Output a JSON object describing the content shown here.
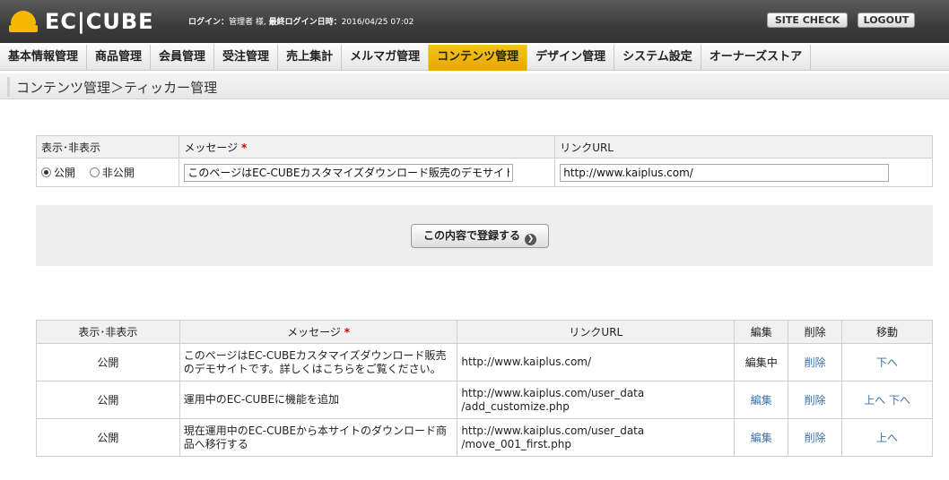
{
  "header": {
    "logo_text": "EC|CUBE",
    "login_label": "ログイン：",
    "user": "管理者 様,",
    "last_login_label": "最終ログイン日時：",
    "last_login": "2016/04/25 07:02",
    "site_check": "SITE CHECK",
    "logout": "LOGOUT",
    "brand_color": "#f5b800"
  },
  "nav": {
    "items": [
      "基本情報管理",
      "商品管理",
      "会員管理",
      "受注管理",
      "売上集計",
      "メルマガ管理",
      "コンテンツ管理",
      "デザイン管理",
      "システム設定",
      "オーナーズストア"
    ],
    "active_index": 6
  },
  "page": {
    "title": "コンテンツ管理＞ティッカー管理"
  },
  "form": {
    "col_display": "表示･非表示",
    "col_message": "メッセージ",
    "required_mark": "*",
    "col_url": "リンクURL",
    "radio_public": "公開",
    "radio_private": "非公開",
    "message_value": "このページはEC-CUBEカスタマイズダウンロード販売のデモサイトで",
    "url_value": "http://www.kaiplus.com/",
    "submit_label": "この内容で登録する"
  },
  "list": {
    "headers": {
      "display": "表示･非表示",
      "message": "メッセージ",
      "url": "リンクURL",
      "edit": "編集",
      "delete": "削除",
      "move": "移動"
    },
    "rows": [
      {
        "display": "公開",
        "message_1": "このページはEC-CUBEカスタマイズダウンロード販売",
        "message_2": "のデモサイトです。詳しくはこちらをご覧ください。",
        "url_1": "http://www.kaiplus.com/",
        "url_2": "",
        "edit": "編集中",
        "delete": "削除",
        "move_up": "",
        "move_down": "下へ"
      },
      {
        "display": "公開",
        "message_1": "運用中のEC-CUBEに機能を追加",
        "message_2": "",
        "url_1": "http://www.kaiplus.com/user_data",
        "url_2": "/add_customize.php",
        "edit": "編集",
        "delete": "削除",
        "move_up": "上へ",
        "move_down": "下へ"
      },
      {
        "display": "公開",
        "message_1": "現在運用中のEC-CUBEから本サイトのダウンロード商",
        "message_2": "品へ移行する",
        "url_1": "http://www.kaiplus.com/user_data",
        "url_2": "/move_001_first.php",
        "edit": "編集",
        "delete": "削除",
        "move_up": "上へ",
        "move_down": ""
      }
    ]
  }
}
